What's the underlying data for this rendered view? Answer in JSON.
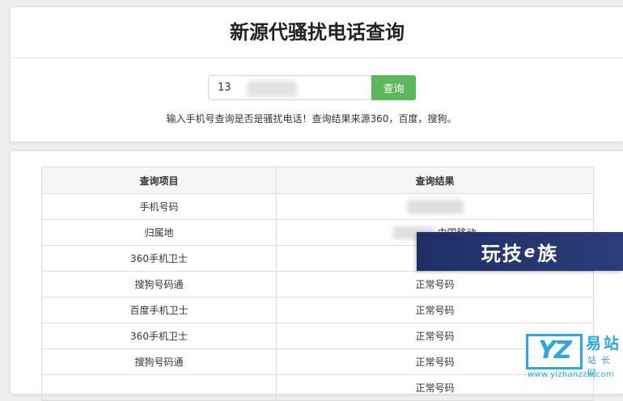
{
  "header": {
    "title": "新源代骚扰电话查询"
  },
  "search": {
    "value": "13",
    "button_label": "查询",
    "hint": "输入手机号查询是否是骚扰电话！查询结果来源360，百度，搜狗。"
  },
  "table": {
    "headers": [
      "查询项目",
      "查询结果"
    ],
    "rows": [
      {
        "item": "手机号码",
        "result": ""
      },
      {
        "item": "归属地",
        "result": "中国移动"
      },
      {
        "item": "360手机卫士",
        "result": ""
      },
      {
        "item": "搜狗号码通",
        "result": "正常号码"
      },
      {
        "item": "百度手机卫士",
        "result": "正常号码"
      },
      {
        "item": "360手机卫士",
        "result": "正常号码"
      },
      {
        "item": "搜狗号码通",
        "result": "正常号码"
      },
      {
        "item": "",
        "result": "正常号码"
      }
    ]
  },
  "watermarks": {
    "banner_text": "玩技",
    "banner_e": "e",
    "banner_suffix": "族",
    "logo_text": "YZ",
    "logo_cn_top": "易站",
    "logo_cn_bottom": "站长网",
    "logo_url": "www.yizhanzzw.com"
  },
  "colors": {
    "button": "#5cb85c",
    "banner": "#25356f",
    "logo": "#2aa8e0"
  }
}
